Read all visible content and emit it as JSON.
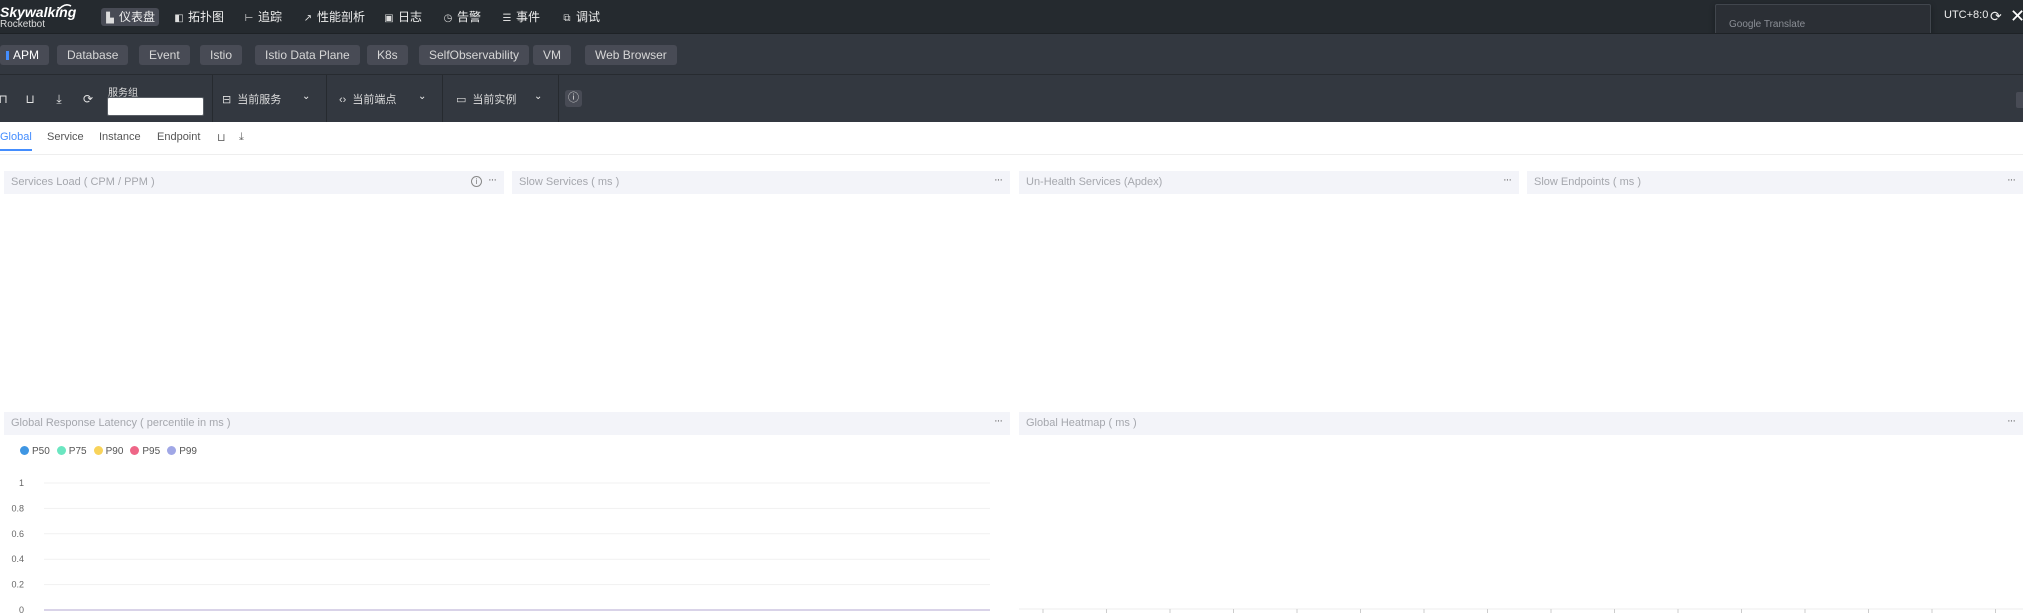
{
  "app": {
    "logo_top": "Skywalking",
    "logo_bottom": "Rocketbot"
  },
  "nav": {
    "items": [
      {
        "label": "仪表盘",
        "icon": "dashboard-icon",
        "active": true
      },
      {
        "label": "拓扑图",
        "icon": "topology-icon",
        "active": false
      },
      {
        "label": "追踪",
        "icon": "trace-icon",
        "active": false
      },
      {
        "label": "性能剖析",
        "icon": "profile-icon",
        "active": false
      },
      {
        "label": "日志",
        "icon": "log-icon",
        "active": false
      },
      {
        "label": "告警",
        "icon": "alarm-icon",
        "active": false
      },
      {
        "label": "事件",
        "icon": "event-icon",
        "active": false
      },
      {
        "label": "调试",
        "icon": "debug-icon",
        "active": false
      }
    ],
    "timezone": "UTC+8:0",
    "google_translate": "Google Translate"
  },
  "layers": [
    {
      "label": "APM",
      "active": true
    },
    {
      "label": "Database"
    },
    {
      "label": "Event"
    },
    {
      "label": "Istio"
    },
    {
      "label": "Istio Data Plane"
    },
    {
      "label": "K8s"
    },
    {
      "label": "SelfObservability"
    },
    {
      "label": "VM"
    },
    {
      "label": "Web Browser"
    }
  ],
  "toolbar": {
    "group_label": "服务组",
    "group_value": "",
    "service_label": "当前服务",
    "endpoint_label": "当前端点",
    "instance_label": "当前实例"
  },
  "dashboard_tabs": [
    {
      "label": "Global",
      "active": true
    },
    {
      "label": "Service"
    },
    {
      "label": "Instance"
    },
    {
      "label": "Endpoint"
    }
  ],
  "widgets": {
    "services_load": "Services Load ( CPM / PPM )",
    "slow_services": "Slow Services ( ms )",
    "unhealth_services": "Un-Health Services (Apdex)",
    "slow_endpoints": "Slow Endpoints ( ms )",
    "global_latency": "Global Response Latency ( percentile in ms )",
    "global_heatmap": "Global Heatmap ( ms )"
  },
  "chart_data": {
    "type": "line",
    "title": "Global Response Latency ( percentile in ms )",
    "series": [
      {
        "name": "P50",
        "color": "#3f96e3",
        "values": []
      },
      {
        "name": "P75",
        "color": "#6be6c1",
        "values": []
      },
      {
        "name": "P90",
        "color": "#f8d35a",
        "values": []
      },
      {
        "name": "P95",
        "color": "#ee6687",
        "values": []
      },
      {
        "name": "P99",
        "color": "#a0a7e6",
        "values": []
      }
    ],
    "yticks": [
      "1",
      "0.8",
      "0.6",
      "0.4",
      "0.2",
      "0"
    ],
    "ylim": [
      0,
      1
    ],
    "grid": true,
    "legend_position": "top-left"
  }
}
